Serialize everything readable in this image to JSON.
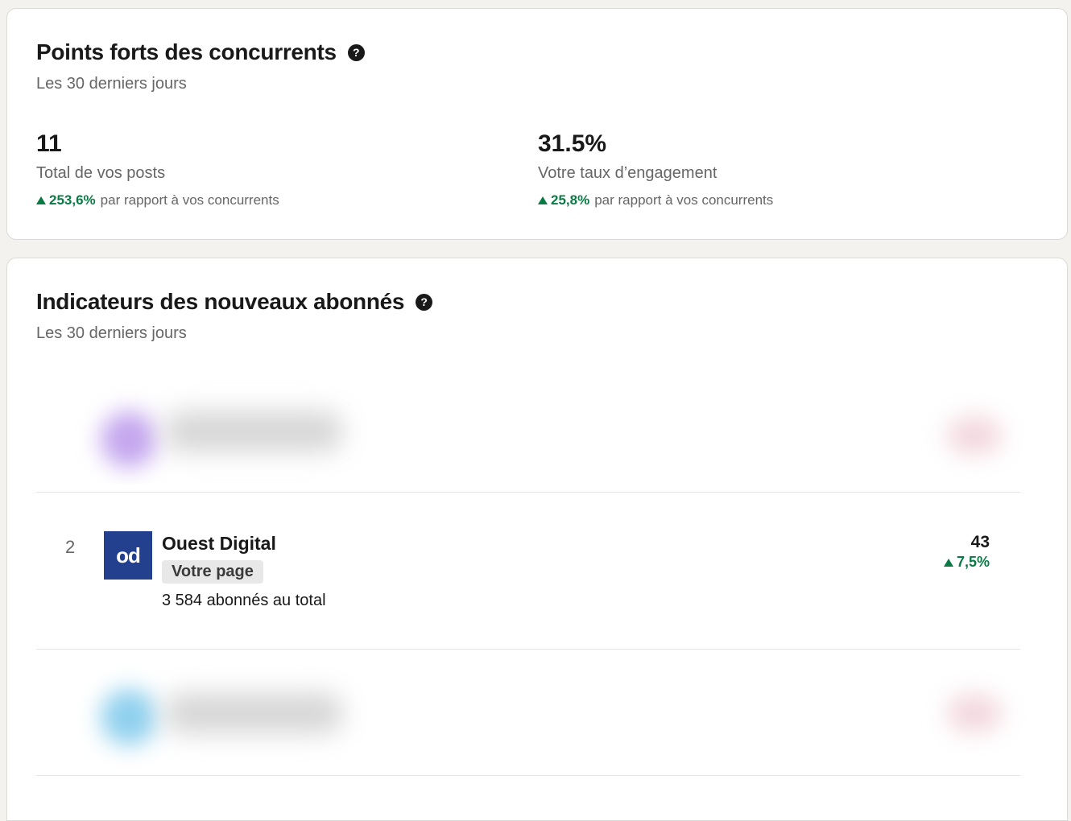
{
  "competitor_highlights": {
    "title": "Points forts des concurrents",
    "help_icon": "question-circle-icon",
    "period": "Les 30 derniers jours",
    "metrics": [
      {
        "value": "11",
        "label": "Total de vos posts",
        "trend": "253,6%",
        "trend_suffix": "par rapport à vos concurrents"
      },
      {
        "value": "31.5%",
        "label": "Votre taux d’engagement",
        "trend": "25,8%",
        "trend_suffix": "par rapport à vos concurrents"
      }
    ]
  },
  "new_followers": {
    "title": "Indicateurs des nouveaux abonnés",
    "help_icon": "question-circle-icon",
    "period": "Les 30 derniers jours",
    "rows": [
      {
        "rank": "2",
        "logo_text": "od",
        "name": "Ouest Digital",
        "badge": "Votre page",
        "followers_total": "3 584 abonnés au total",
        "count": "43",
        "trend": "7,5%"
      }
    ]
  },
  "colors": {
    "positive": "#0a7a45",
    "logo_background": "#23408e",
    "page_background": "#f4f2ee"
  }
}
